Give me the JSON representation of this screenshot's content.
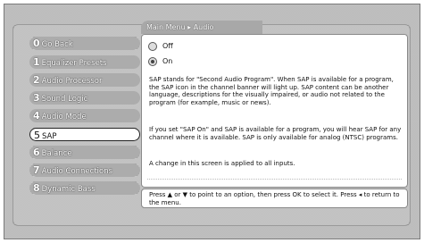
{
  "breadcrumb": "Main Menu ▸ Audio",
  "menu": [
    {
      "num": "0",
      "label": "Go Back"
    },
    {
      "num": "1",
      "label": "Equalizer Presets"
    },
    {
      "num": "2",
      "label": "Audio Processor"
    },
    {
      "num": "3",
      "label": "Sound Logic"
    },
    {
      "num": "4",
      "label": "Audio Mode"
    },
    {
      "num": "5",
      "label": "SAP"
    },
    {
      "num": "6",
      "label": "Balance"
    },
    {
      "num": "7",
      "label": "Audio Connections"
    },
    {
      "num": "8",
      "label": "Dynamic Bass"
    }
  ],
  "selected_index": 5,
  "options": [
    {
      "label": "Off",
      "checked": false
    },
    {
      "label": "On",
      "checked": true
    }
  ],
  "paragraphs": [
    "SAP stands for \"Second Audio Program\".  When SAP is available for a program, the SAP icon in the channel banner will light up. SAP content can be another language, descriptions for the visually impaired, or audio not related to the program (for example, music or news).",
    "If you set \"SAP On\" and SAP is available for a program, you will hear SAP for any channel where it is available. SAP is only available for analog (NTSC) programs.",
    "A change in this screen is applied to all inputs."
  ],
  "footer": "Press ▲ or ▼ to point to an option, then press OK to select it. Press ◂ to return to the menu."
}
